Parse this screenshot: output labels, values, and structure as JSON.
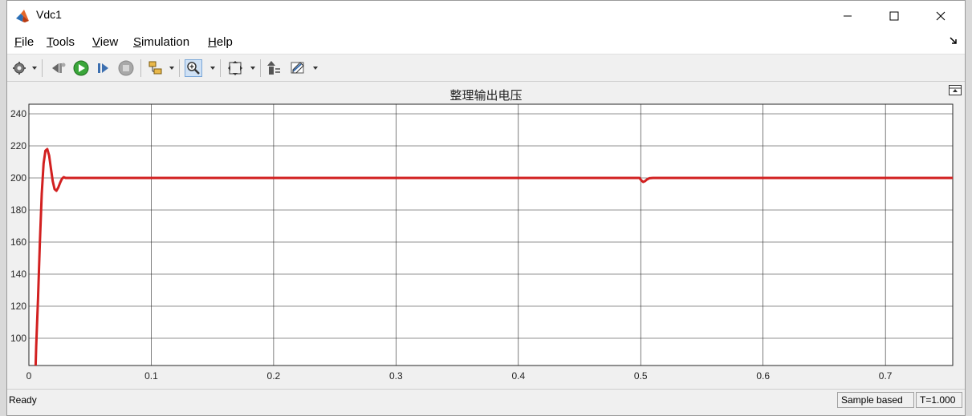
{
  "window": {
    "title": "Vdc1"
  },
  "menu": [
    {
      "label": "File",
      "mnemonic": "F",
      "rest": "ile"
    },
    {
      "label": "Tools",
      "mnemonic": "T",
      "rest": "ools"
    },
    {
      "label": "View",
      "mnemonic": "V",
      "rest": "iew"
    },
    {
      "label": "Simulation",
      "mnemonic": "S",
      "rest": "imulation"
    },
    {
      "label": "Help",
      "mnemonic": "H",
      "rest": "elp"
    }
  ],
  "toolbar": {
    "icons": [
      "gear-icon",
      "step-back-icon",
      "run-icon",
      "step-forward-icon",
      "stop-icon",
      "signal-select-icon",
      "zoom-icon",
      "fit-icon",
      "highlight-icon",
      "style-icon"
    ],
    "zoom_pressed": true
  },
  "status": {
    "text": "Ready",
    "mode": "Sample based",
    "time": "T=1.000"
  },
  "chart_data": {
    "type": "line",
    "title": "整理输出电压",
    "xlabel": "",
    "ylabel": "",
    "xlim": [
      0,
      0.755
    ],
    "ylim": [
      83,
      246
    ],
    "xticks": [
      0,
      0.1,
      0.2,
      0.3,
      0.4,
      0.5,
      0.6,
      0.7
    ],
    "yticks": [
      100,
      120,
      140,
      160,
      180,
      200,
      220,
      240
    ],
    "xtick_labels": [
      "0",
      "0.1",
      "0.2",
      "0.3",
      "0.4",
      "0.5",
      "0.6",
      "0.7"
    ],
    "ytick_labels": [
      "100",
      "120",
      "140",
      "160",
      "180",
      "200",
      "220",
      "240"
    ],
    "grid": true,
    "series": [
      {
        "color": "#d22020",
        "x": [
          0.0055,
          0.006,
          0.0075,
          0.009,
          0.0105,
          0.012,
          0.0135,
          0.015,
          0.0165,
          0.018,
          0.0195,
          0.021,
          0.0225,
          0.024,
          0.0255,
          0.027,
          0.0285,
          0.03,
          0.035,
          0.1,
          0.2,
          0.3,
          0.4,
          0.499,
          0.5005,
          0.502,
          0.5035,
          0.505,
          0.507,
          0.51,
          0.6,
          0.755
        ],
        "y": [
          83,
          95,
          125,
          160,
          190,
          209,
          217,
          218,
          214,
          206,
          198,
          193,
          192,
          194,
          197,
          199.5,
          200.5,
          200,
          200,
          200,
          200,
          200,
          200,
          200,
          198.5,
          197.5,
          198,
          199,
          199.8,
          200,
          200,
          200
        ]
      }
    ]
  }
}
